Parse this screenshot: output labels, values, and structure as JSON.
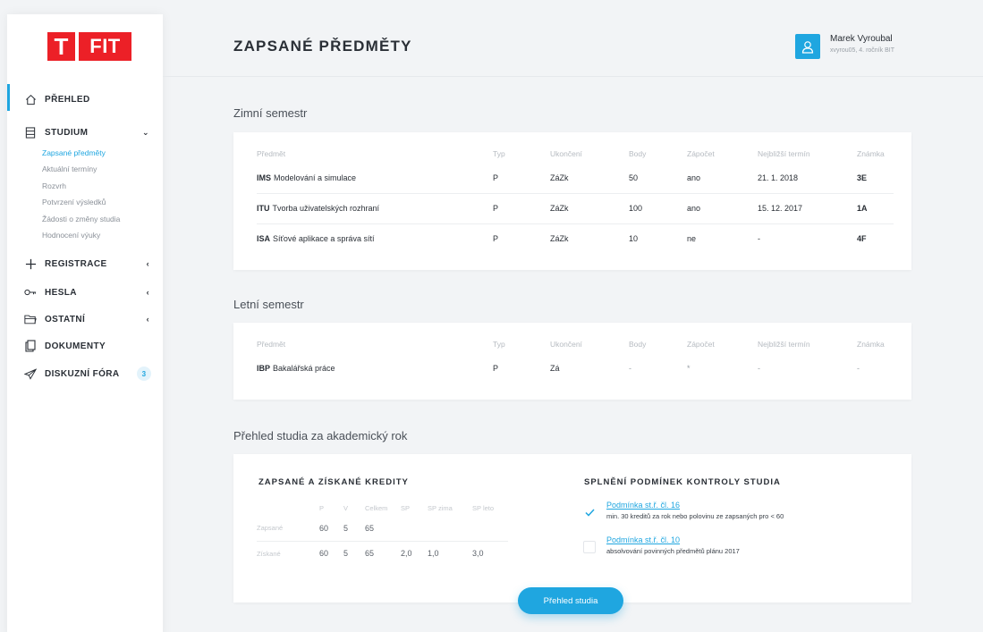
{
  "logo": {
    "t": "T",
    "fit": "FIT"
  },
  "sidebar": {
    "items": [
      {
        "label": "PŘEHLED",
        "icon": "home-icon"
      },
      {
        "label": "STUDIUM",
        "icon": "book-icon"
      },
      {
        "label": "REGISTRACE",
        "icon": "plus-icon"
      },
      {
        "label": "HESLA",
        "icon": "key-icon"
      },
      {
        "label": "OSTATNÍ",
        "icon": "folder-icon"
      },
      {
        "label": "DOKUMENTY",
        "icon": "documents-icon"
      },
      {
        "label": "DISKUZNÍ FÓRA",
        "icon": "paper-plane-icon",
        "badge": "3"
      }
    ],
    "studium_sub": [
      "Zapsané předměty",
      "Aktuální termíny",
      "Rozvrh",
      "Potvrzení výsledků",
      "Žádosti o změny studia",
      "Hodnocení výuky"
    ]
  },
  "header": {
    "title": "ZAPSANÉ PŘEDMĚTY",
    "user_name": "Marek Vyroubal",
    "user_sub": "xvyrou05, 4. ročník BIT"
  },
  "columns": [
    "Předmět",
    "Typ",
    "Ukončení",
    "Body",
    "Zápočet",
    "Nejbližší termín",
    "Známka"
  ],
  "winter": {
    "title": "Zimní semestr",
    "rows": [
      {
        "code": "IMS",
        "name": "Modelování a simulace",
        "typ": "P",
        "ukonceni": "ZáZk",
        "body": "50",
        "zapocet": "ano",
        "termin": "21. 1. 2018",
        "znamka": "3E"
      },
      {
        "code": "ITU",
        "name": "Tvorba uživatelských rozhraní",
        "typ": "P",
        "ukonceni": "ZáZk",
        "body": "100",
        "zapocet": "ano",
        "termin": "15. 12. 2017",
        "znamka": "1A"
      },
      {
        "code": "ISA",
        "name": "Síťové aplikace a správa sítí",
        "typ": "P",
        "ukonceni": "ZáZk",
        "body": "10",
        "zapocet": "ne",
        "termin": "-",
        "znamka": "4F"
      }
    ]
  },
  "summer": {
    "title": "Letní semestr",
    "rows": [
      {
        "code": "IBP",
        "name": "Bakalářská práce",
        "typ": "P",
        "ukonceni": "Zá",
        "body": "-",
        "zapocet": "*",
        "termin": "-",
        "znamka": "-"
      }
    ]
  },
  "overview": {
    "title": "Přehled studia za akademický rok",
    "credits_title": "ZAPSANÉ A ZÍSKANÉ KREDITY",
    "credits_cols": [
      "P",
      "V",
      "Celkem",
      "SP",
      "SP zima",
      "SP leto"
    ],
    "credits_rows": [
      {
        "label": "Zapsané",
        "values": [
          "60",
          "5",
          "65",
          "",
          "",
          ""
        ]
      },
      {
        "label": "Získané",
        "values": [
          "60",
          "5",
          "65",
          "2,0",
          "1,0",
          "3,0"
        ]
      }
    ],
    "conditions_title": "SPLNĚNÍ PODMÍNEK KONTROLY STUDIA",
    "conditions": [
      {
        "link": "Podmínka st.ř. čl. 16",
        "desc": "min. 30 kreditů za rok nebo polovinu ze zapsaných pro < 60",
        "checked": true
      },
      {
        "link": "Podmínka st.ř. čl. 10",
        "desc": "absolvování povinných předmětů plánu 2017",
        "checked": false
      }
    ],
    "button": "Přehled studia"
  },
  "colors": {
    "accent": "#1fa6e0",
    "brand": "#ec2027",
    "yes": "#2e9b2e",
    "no": "#e6202b"
  }
}
